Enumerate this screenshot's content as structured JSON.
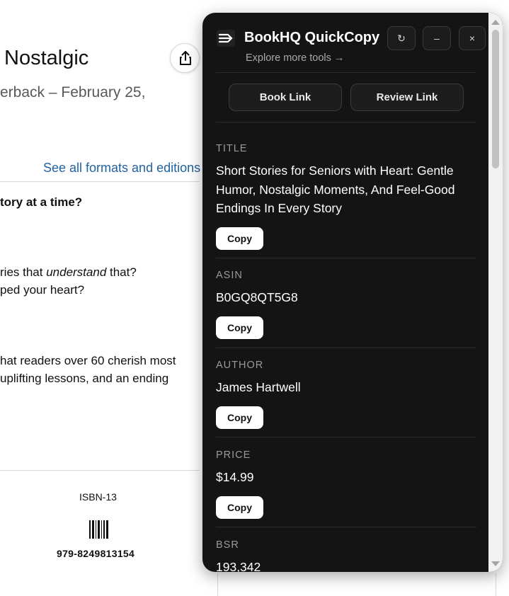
{
  "background_page": {
    "title": "Nostalgic",
    "format_line": "erback – February 25,",
    "formats_link": "See all formats and editions",
    "question": "tory at a time?",
    "line1_pre": "ries that ",
    "line1_em": "understand",
    "line1_post": " that?",
    "line2": "ped your heart?",
    "line3": "hat readers over 60 cherish most",
    "line4": " uplifting lessons, and an ending",
    "isbn_label": "ISBN-13",
    "isbn_value": "979-8249813154"
  },
  "panel": {
    "title": "BookHQ QuickCopy",
    "subtitle": "Explore more tools →",
    "header_buttons": {
      "refresh": "↻",
      "minimize": "–",
      "close": "×"
    },
    "link_buttons": {
      "book": "Book Link",
      "review": "Review Link"
    },
    "copy_label": "Copy",
    "fields": [
      {
        "label": "TITLE",
        "value": "Short Stories for Seniors with Heart: Gentle Humor, Nostalgic Moments, And Feel-Good Endings In Every Story"
      },
      {
        "label": "ASIN",
        "value": "B0GQ8QT5G8"
      },
      {
        "label": "AUTHOR",
        "value": "James Hartwell"
      },
      {
        "label": "PRICE",
        "value": "$14.99"
      },
      {
        "label": "BSR",
        "value": "193,342"
      }
    ]
  },
  "icons": [
    "share-icon",
    "menu-arrow-icon",
    "refresh-icon",
    "minimize-icon",
    "close-icon",
    "barcode-icon"
  ],
  "colors": {
    "panel_bg": "#141414",
    "link_blue": "#2162a1",
    "copy_button_bg": "#ffffff"
  }
}
